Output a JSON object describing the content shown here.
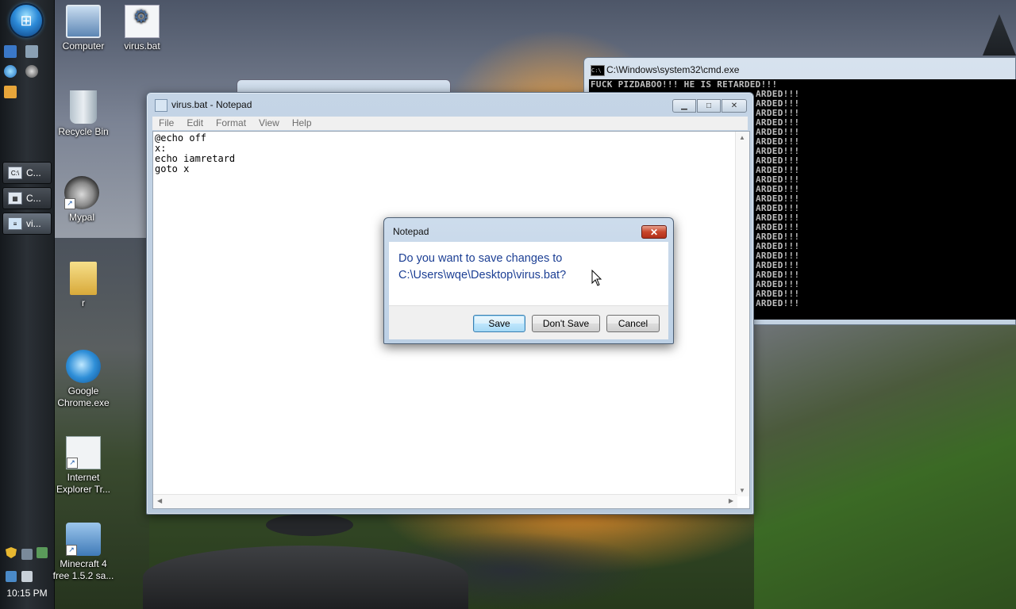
{
  "desktop": {
    "icons": [
      {
        "label": "Computer"
      },
      {
        "label": "virus.bat"
      },
      {
        "label": "Recycle Bin"
      },
      {
        "label": "Mypal"
      },
      {
        "label": "r"
      },
      {
        "label": "Google Chrome.exe"
      },
      {
        "label": "Internet Explorer Tr..."
      },
      {
        "label": "Minecraft 4 free 1.5.2 sa..."
      }
    ]
  },
  "taskbar": {
    "start_icon": "windows-orb-icon",
    "tasks": [
      {
        "label": "C...",
        "icon": "cmd-icon"
      },
      {
        "label": "C...",
        "icon": "calculator-icon"
      },
      {
        "label": "vi...",
        "icon": "notepad-icon"
      }
    ],
    "clock": "10:15 PM"
  },
  "notepad": {
    "title": "virus.bat - Notepad",
    "menu": [
      "File",
      "Edit",
      "Format",
      "View",
      "Help"
    ],
    "content": "@echo off\nx:\necho iamretard\ngoto x"
  },
  "cmd": {
    "title": "C:\\Windows\\system32\\cmd.exe",
    "first_line": "FUCK PIZDABOO!!! HE IS RETARDED!!!",
    "repeat_text": "ARDED!!!",
    "repeat_count": 23
  },
  "dialog": {
    "title": "Notepad",
    "message_line1": "Do you want to save changes to",
    "message_line2": "C:\\Users\\wqe\\Desktop\\virus.bat?",
    "buttons": {
      "save": "Save",
      "dont_save": "Don't Save",
      "cancel": "Cancel"
    }
  }
}
